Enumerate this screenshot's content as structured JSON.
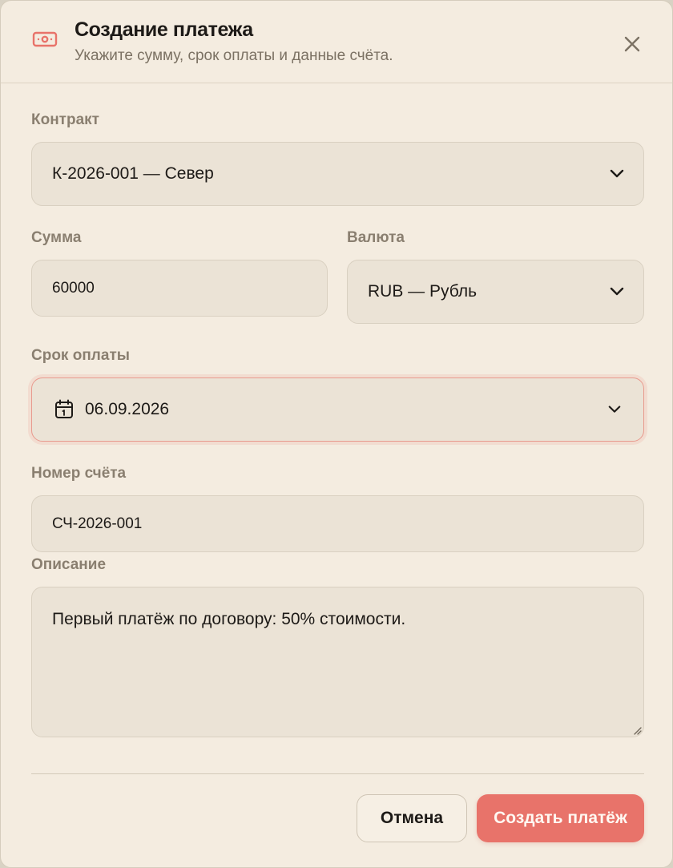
{
  "dialog": {
    "title": "Создание платежа",
    "subtitle": "Укажите сумму, срок оплаты и данные счёта.",
    "icon": "banknote-icon",
    "accent_color": "#e8736a"
  },
  "form": {
    "contract": {
      "label": "Контракт",
      "value": "К-2026-001 — Север"
    },
    "amount": {
      "label": "Сумма",
      "value": "60000"
    },
    "currency": {
      "label": "Валюта",
      "value": "RUB — Рубль"
    },
    "due_date": {
      "label": "Срок оплаты",
      "value": "06.09.2026"
    },
    "invoice_number": {
      "label": "Номер счёта",
      "value": "СЧ-2026-001"
    },
    "description": {
      "label": "Описание",
      "value": "Первый платёж по договору: 50% стоимости."
    }
  },
  "actions": {
    "cancel_label": "Отмена",
    "create_label": "Создать платёж"
  }
}
